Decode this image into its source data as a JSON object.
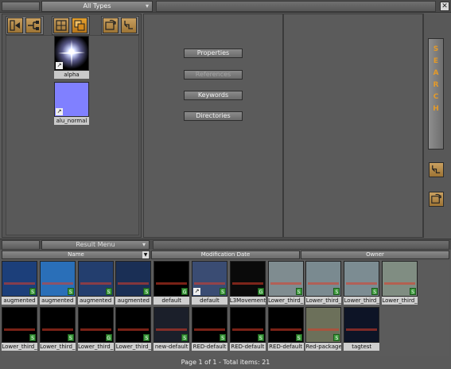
{
  "topbar": {
    "type_filter": "All Types",
    "close_glyph": "✕"
  },
  "tree": {
    "toolbar_icons": [
      "tree-expand-icon",
      "tree-structure-icon",
      "folder-view-icon",
      "folder-view-active-icon",
      "refresh-icon",
      "hierarchy-icon"
    ],
    "assets": [
      {
        "label": "alpha",
        "thumb_color": "#000000"
      },
      {
        "label": "alu_normal",
        "thumb_color": "#8080ff"
      }
    ]
  },
  "middle": {
    "buttons": [
      {
        "label": "Properties",
        "enabled": true
      },
      {
        "label": "References",
        "enabled": false
      },
      {
        "label": "Keywords",
        "enabled": true
      },
      {
        "label": "Directories",
        "enabled": true
      }
    ]
  },
  "side": {
    "search_letters": [
      "S",
      "E",
      "A",
      "R",
      "C",
      "H"
    ],
    "icons": [
      "tree-icon",
      "refresh-icon"
    ]
  },
  "result_menu": {
    "label": "Result Menu"
  },
  "columns": [
    "Name",
    "Modification Date",
    "Owner"
  ],
  "results": [
    {
      "label": "augmented",
      "bg": "#1c3f7a",
      "badge": "S",
      "link": false
    },
    {
      "label": "augmented",
      "bg": "#2a6fb8",
      "badge": "S",
      "link": false
    },
    {
      "label": "augmented",
      "bg": "#233e6e",
      "badge": "S",
      "link": false
    },
    {
      "label": "augmented",
      "bg": "#1a2f55",
      "badge": "S",
      "link": false
    },
    {
      "label": "default",
      "bg": "#000000",
      "badge": "G",
      "link": false
    },
    {
      "label": "default",
      "bg": "#3a4c73",
      "badge": "S",
      "link": true
    },
    {
      "label": "L3Movement",
      "bg": "#0a0a0a",
      "badge": "G",
      "link": false
    },
    {
      "label": "Lower_third_",
      "bg": "#7f8c90",
      "badge": "S",
      "link": false
    },
    {
      "label": "Lower_third_",
      "bg": "#7a8a90",
      "badge": "S",
      "link": false
    },
    {
      "label": "Lower_third_",
      "bg": "#7c8c92",
      "badge": "S",
      "link": false
    },
    {
      "label": "Lower_third_",
      "bg": "#808d82",
      "badge": "S",
      "link": false
    },
    {
      "label": "Lower_third_",
      "bg": "#000000",
      "badge": "S",
      "link": false
    },
    {
      "label": "Lower_third_",
      "bg": "#000000",
      "badge": "S",
      "link": false
    },
    {
      "label": "Lower_third_",
      "bg": "#000000",
      "badge": "G",
      "link": false
    },
    {
      "label": "Lower_third_",
      "bg": "#000000",
      "badge": "S",
      "link": false
    },
    {
      "label": "new-default",
      "bg": "#1b1f2a",
      "badge": "S",
      "link": false
    },
    {
      "label": "RED-default",
      "bg": "#000000",
      "badge": "S",
      "link": false
    },
    {
      "label": "RED-default",
      "bg": "#000000",
      "badge": "S",
      "link": false
    },
    {
      "label": "RED-default",
      "bg": "#000000",
      "badge": "S",
      "link": false
    },
    {
      "label": "Red-package",
      "bg": "#6c705a",
      "badge": "S",
      "link": false
    },
    {
      "label": "tagtest",
      "bg": "#0d1426",
      "badge": "",
      "link": false
    }
  ],
  "status": "Page 1 of 1 - Total items: 21",
  "colors": {
    "accent": "#e39a2a",
    "button_gold": "#b88a45",
    "panel": "#5b5b5b"
  }
}
